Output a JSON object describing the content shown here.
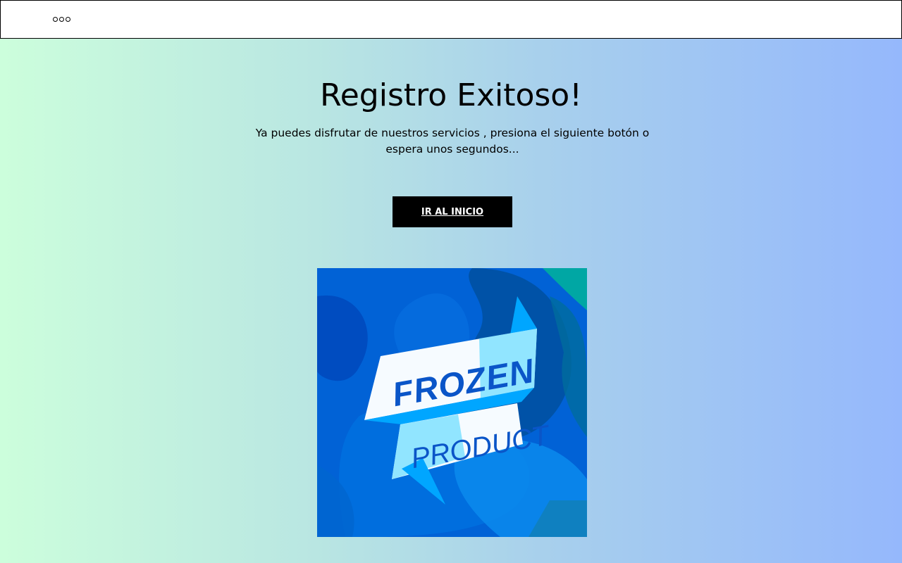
{
  "header": {
    "menu_icon": "more-dots-icon"
  },
  "main": {
    "title": "Registro Exitoso!",
    "subtitle": "Ya puedes disfrutar de nuestros servicios , presiona el siguiente botón o espera unos segundos...",
    "button_label": "IR AL INICIO"
  },
  "banner": {
    "line1": "FROZEN",
    "line2": "PRODUCT"
  },
  "colors": {
    "button_bg": "#000000",
    "banner_blue": "#0062d6",
    "ribbon_light": "#7fe0ff"
  }
}
